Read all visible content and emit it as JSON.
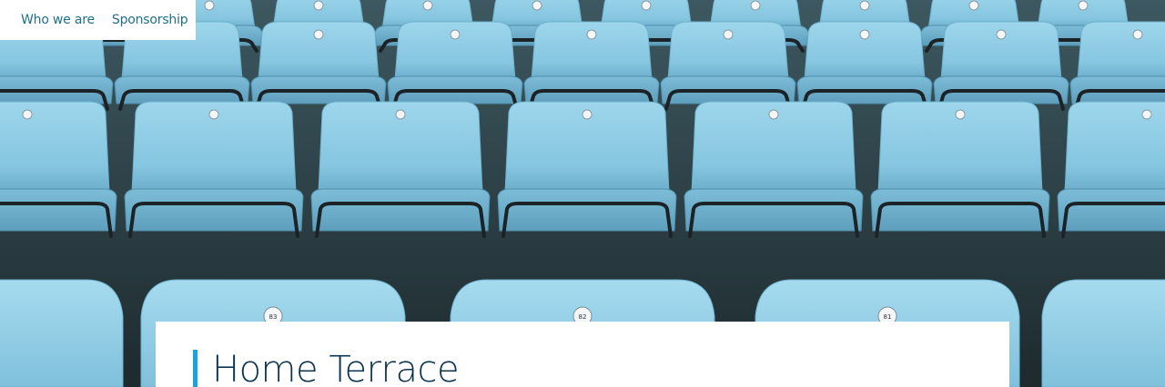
{
  "nav": {
    "items": [
      {
        "label": "Who we are"
      },
      {
        "label": "Sponsorship"
      }
    ]
  },
  "hero": {
    "image": "blue stadium seats",
    "seat_numbers": [
      "83",
      "82",
      "81"
    ]
  },
  "page": {
    "title": "Home Terrace"
  },
  "colors": {
    "seat": "#8ecde6",
    "seat_shadow": "#4f90ad",
    "nav_text": "#1f6e8c",
    "title_text": "#0d3450",
    "accent": "#1aa3dc"
  }
}
